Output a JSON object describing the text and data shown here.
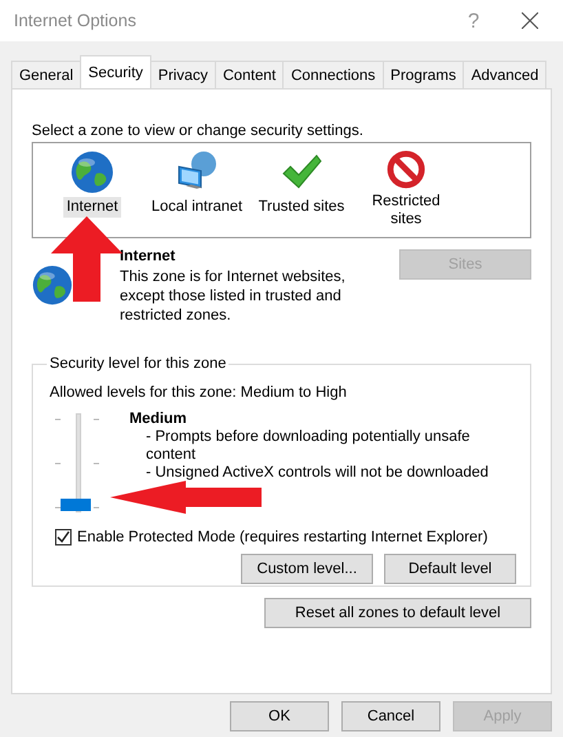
{
  "window": {
    "title": "Internet Options",
    "help": "?"
  },
  "tabs": [
    {
      "label": "General",
      "selected": false
    },
    {
      "label": "Security",
      "selected": true
    },
    {
      "label": "Privacy",
      "selected": false
    },
    {
      "label": "Content",
      "selected": false
    },
    {
      "label": "Connections",
      "selected": false
    },
    {
      "label": "Programs",
      "selected": false
    },
    {
      "label": "Advanced",
      "selected": false
    }
  ],
  "zones": {
    "prompt": "Select a zone to view or change security settings.",
    "items": [
      {
        "label": "Internet",
        "kind": "globe",
        "selected": true
      },
      {
        "label": "Local intranet",
        "kind": "network",
        "selected": false
      },
      {
        "label": "Trusted sites",
        "kind": "check",
        "selected": false
      },
      {
        "label": "Restricted sites",
        "kind": "blocked",
        "selected": false
      }
    ]
  },
  "zone_info": {
    "heading": "Internet",
    "description": "This zone is for Internet websites, except those listed in trusted and restricted zones.",
    "sites_button": {
      "label": "Sites",
      "disabled": true
    }
  },
  "security_level": {
    "group_title": "Security level for this zone",
    "allowed": "Allowed levels for this zone: Medium to High",
    "slider": {
      "level": 0
    },
    "level_name": "Medium",
    "details": [
      "- Prompts before downloading potentially unsafe content",
      "- Unsigned ActiveX controls will not be downloaded"
    ],
    "protected_mode": {
      "label": "Enable Protected Mode (requires restarting Internet Explorer)",
      "checked": true
    },
    "buttons": [
      {
        "label": "Custom level..."
      },
      {
        "label": "Default level"
      }
    ]
  },
  "reset_button": {
    "label": "Reset all zones to default level"
  },
  "footer_buttons": [
    {
      "label": "OK",
      "disabled": false
    },
    {
      "label": "Cancel",
      "disabled": false
    },
    {
      "label": "Apply",
      "disabled": true
    }
  ]
}
